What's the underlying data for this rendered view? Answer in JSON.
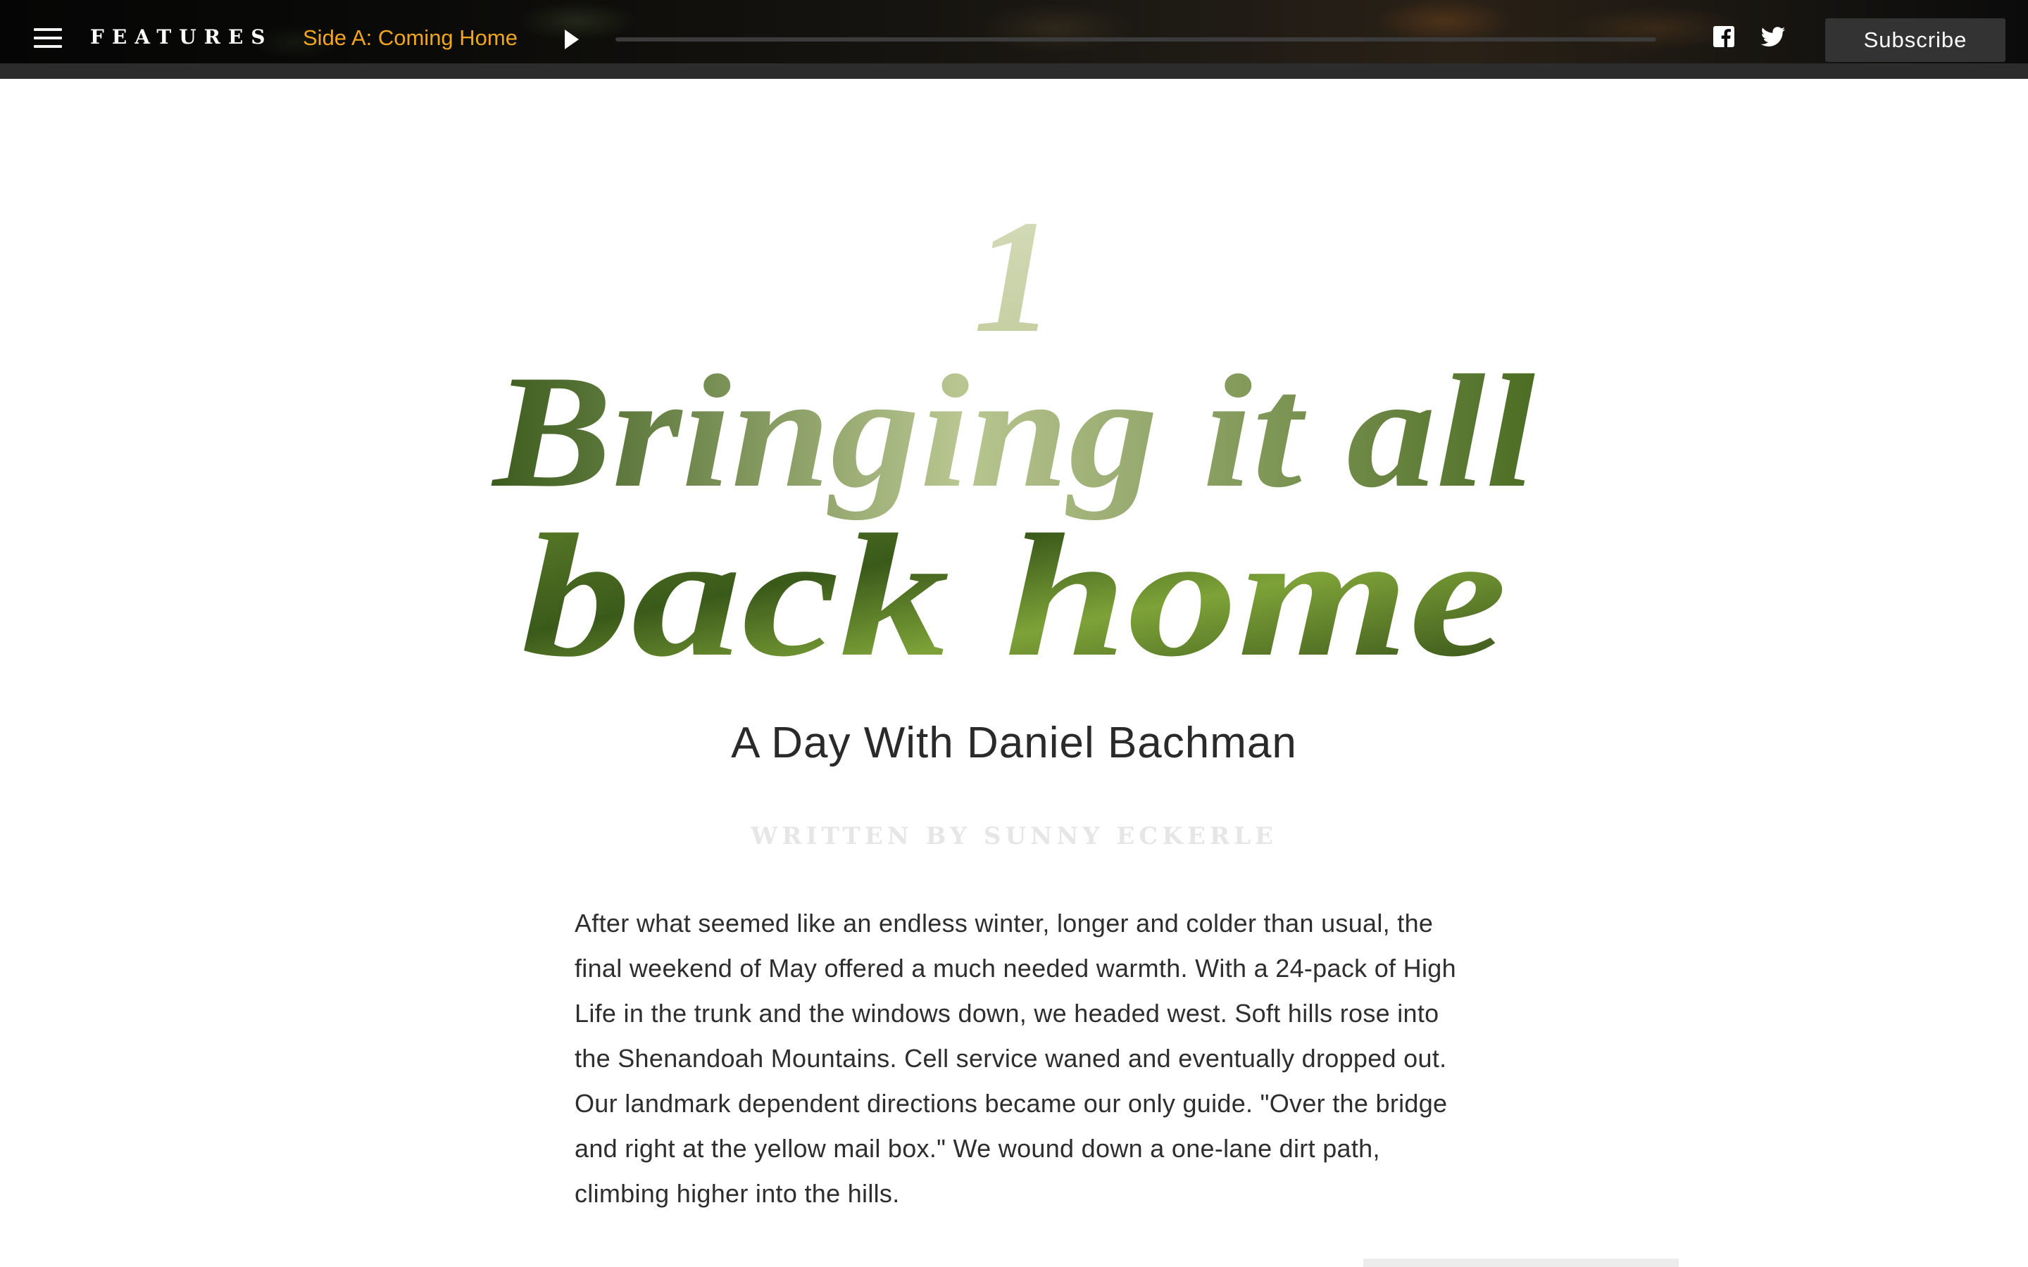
{
  "topbar": {
    "brand": "FEATURES",
    "track_title": "Side A: Coming Home",
    "subscribe_label": "Subscribe",
    "playback_progress": 0.0,
    "icons": [
      "menu-icon",
      "play-icon",
      "facebook-icon",
      "twitter-icon"
    ],
    "accent_color": "#f0a51e"
  },
  "article": {
    "chapter_number": "1",
    "title_line1": "Bringing it all",
    "title_line2": "back home",
    "subtitle": "A Day With Daniel Bachman",
    "byline": "WRITTEN BY SUNNY ECKERLE",
    "body": "After what seemed like an endless winter, longer and colder than usual, the final weekend of May offered a much needed warmth. With a 24-pack of High Life in the trunk and the windows down, we headed west. Soft hills rose into the Shenandoah Mountains. Cell service waned and eventually dropped out. Our landmark dependent directions became our only guide. \"Over the bridge and right at the yellow mail box.\" We wound down a one-lane dirt path, climbing higher into the hills."
  }
}
